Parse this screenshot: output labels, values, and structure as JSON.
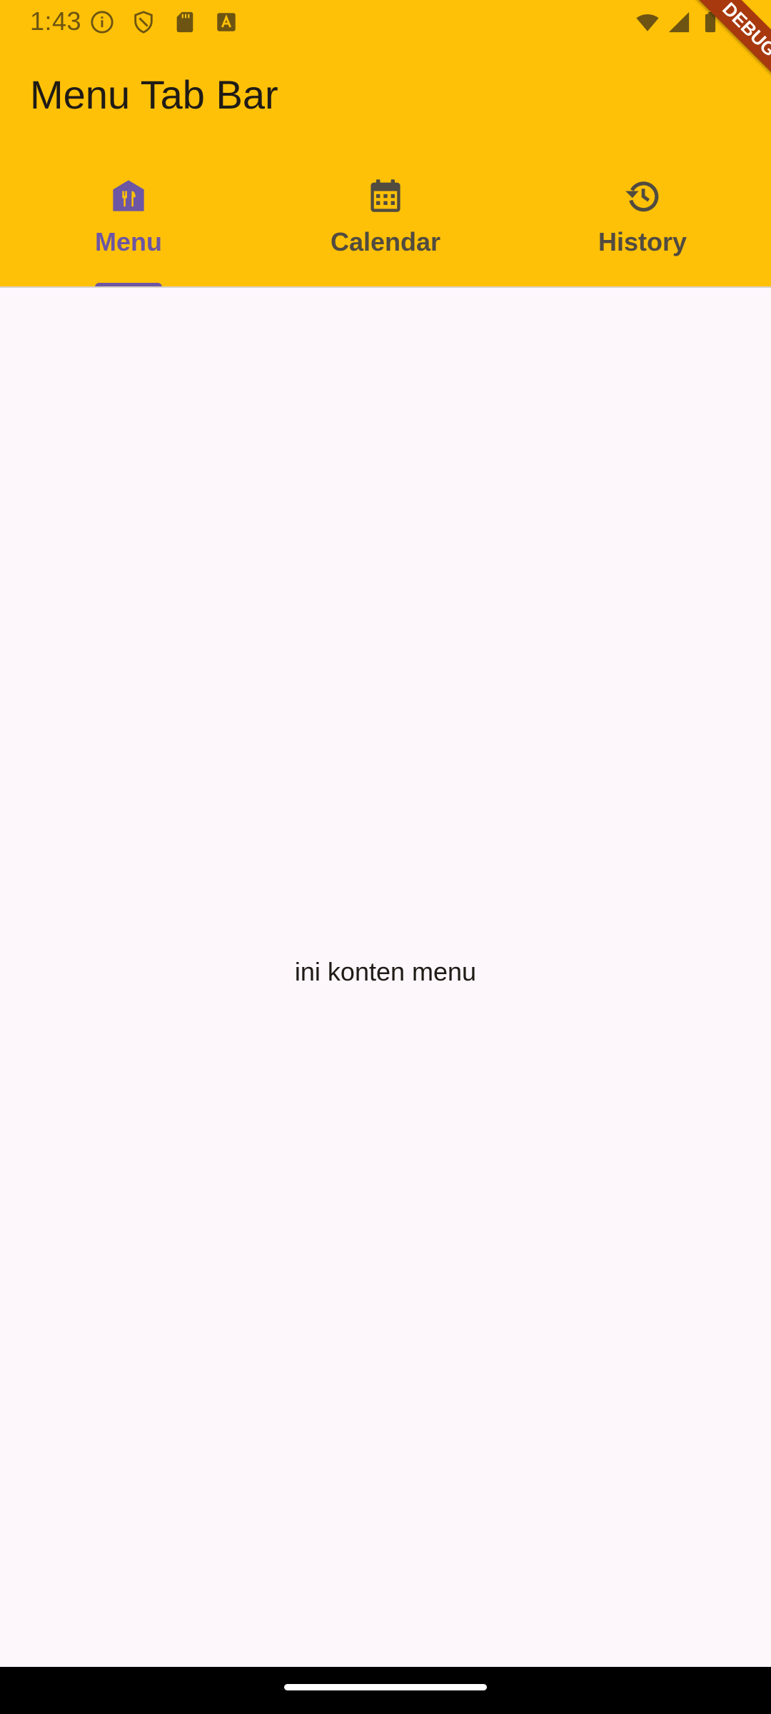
{
  "status_bar": {
    "time": "1:43",
    "left_icons": [
      "info-icon",
      "shield-icon",
      "sd-card-icon",
      "keyboard-a-icon"
    ],
    "right_icons": [
      "wifi-icon",
      "signal-icon",
      "battery-icon"
    ]
  },
  "app_bar": {
    "title": "Menu Tab Bar",
    "color": "#ffc107"
  },
  "tabs": [
    {
      "label": "Menu",
      "icon": "restaurant-house-icon",
      "active": true
    },
    {
      "label": "Calendar",
      "icon": "calendar-icon",
      "active": false
    },
    {
      "label": "History",
      "icon": "history-icon",
      "active": false
    }
  ],
  "accent_color": "#6d56a3",
  "content": {
    "text": "ini konten menu"
  },
  "debug_banner": {
    "text": "DEBUG"
  }
}
